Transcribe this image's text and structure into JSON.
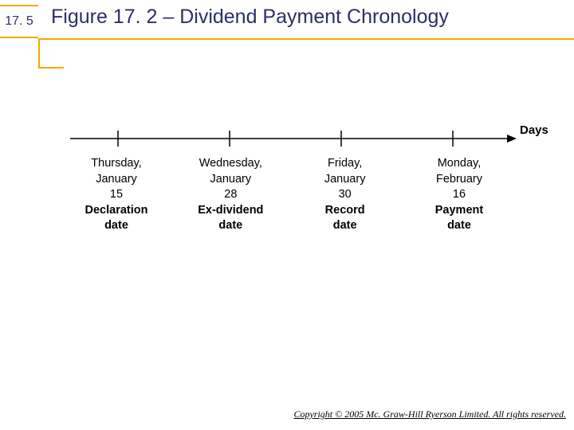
{
  "slide": {
    "section_number": "17. 5",
    "title": "Figure 17. 2 – Dividend Payment Chronology",
    "axis_label": "Days",
    "events": [
      {
        "day": "Thursday,",
        "month": "January",
        "num": "15",
        "label1": "Declaration",
        "label2": "date"
      },
      {
        "day": "Wednesday,",
        "month": "January",
        "num": "28",
        "label1": "Ex-dividend",
        "label2": "date"
      },
      {
        "day": "Friday,",
        "month": "January",
        "num": "30",
        "label1": "Record",
        "label2": "date"
      },
      {
        "day": "Monday,",
        "month": "February",
        "num": "16",
        "label1": "Payment",
        "label2": "date"
      }
    ],
    "copyright": "Copyright © 2005 Mc. Graw-Hill Ryerson Limited. All rights reserved."
  },
  "chart_data": {
    "type": "timeline",
    "title": "Figure 17. 2 – Dividend Payment Chronology",
    "axis": "Days",
    "points": [
      {
        "event": "Declaration date",
        "weekday": "Thursday",
        "month": "January",
        "day": 15
      },
      {
        "event": "Ex-dividend date",
        "weekday": "Wednesday",
        "month": "January",
        "day": 28
      },
      {
        "event": "Record date",
        "weekday": "Friday",
        "month": "January",
        "day": 30
      },
      {
        "event": "Payment date",
        "weekday": "Monday",
        "month": "February",
        "day": 16
      }
    ]
  }
}
